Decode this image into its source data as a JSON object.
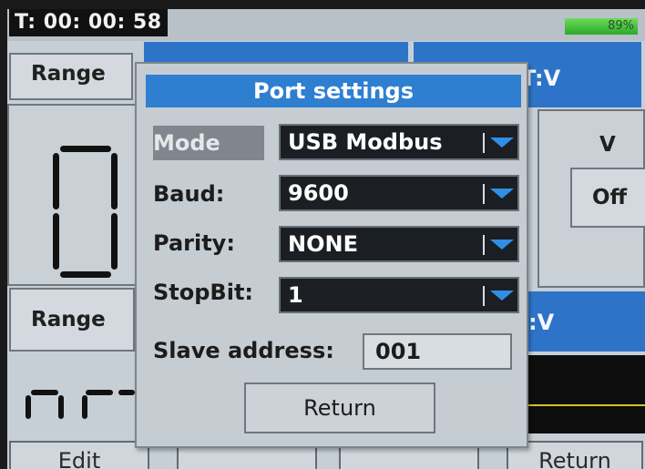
{
  "status": {
    "timer": "T: 00: 00: 58",
    "battery": "89%"
  },
  "background": {
    "range_top": "Range",
    "range_bottom": "Range",
    "channel_top_label": "T:V",
    "channel_bottom_label": ":V",
    "unit": "V",
    "off_button": "Off"
  },
  "dialog": {
    "title": "Port settings",
    "mode_label": "Mode",
    "mode_value": "USB Modbus",
    "baud_label": "Baud:",
    "baud_value": "9600",
    "parity_label": "Parity:",
    "parity_value": "NONE",
    "stopbit_label": "StopBit:",
    "stopbit_value": "1",
    "slave_label": "Slave address:",
    "slave_value": "001",
    "return_label": "Return"
  },
  "softkeys": {
    "edit": "Edit",
    "key2": "",
    "key3": "",
    "return": "Return"
  },
  "colors": {
    "dialog_title_bg": "#2f7fd1",
    "dropdown_bg": "#1b1f23",
    "dropdown_arrow": "#2f8fe6",
    "battery_fill": "#3fbf3a"
  }
}
